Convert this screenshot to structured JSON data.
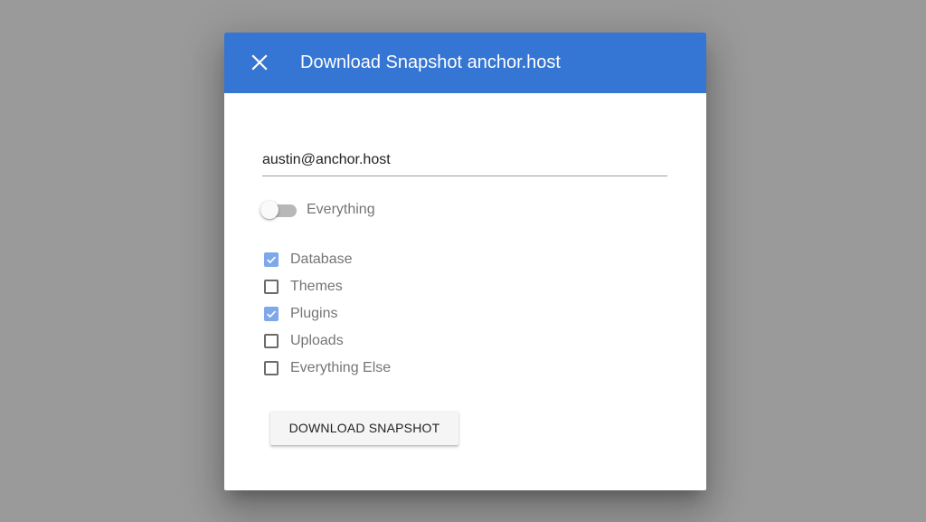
{
  "dialog": {
    "title": "Download Snapshot anchor.host",
    "close_icon": "close-icon",
    "toolbar_color": "#3575d3"
  },
  "email": {
    "value": "austin@anchor.host"
  },
  "everything_toggle": {
    "label": "Everything",
    "on": false
  },
  "options": [
    {
      "label": "Database",
      "checked": true
    },
    {
      "label": "Themes",
      "checked": false
    },
    {
      "label": "Plugins",
      "checked": true
    },
    {
      "label": "Uploads",
      "checked": false
    },
    {
      "label": "Everything Else",
      "checked": false
    }
  ],
  "download_button": {
    "label": "DOWNLOAD SNAPSHOT"
  },
  "colors": {
    "accent": "#3575d3",
    "checked": "#7ea8ea",
    "overlay": "#9a9a9a"
  }
}
